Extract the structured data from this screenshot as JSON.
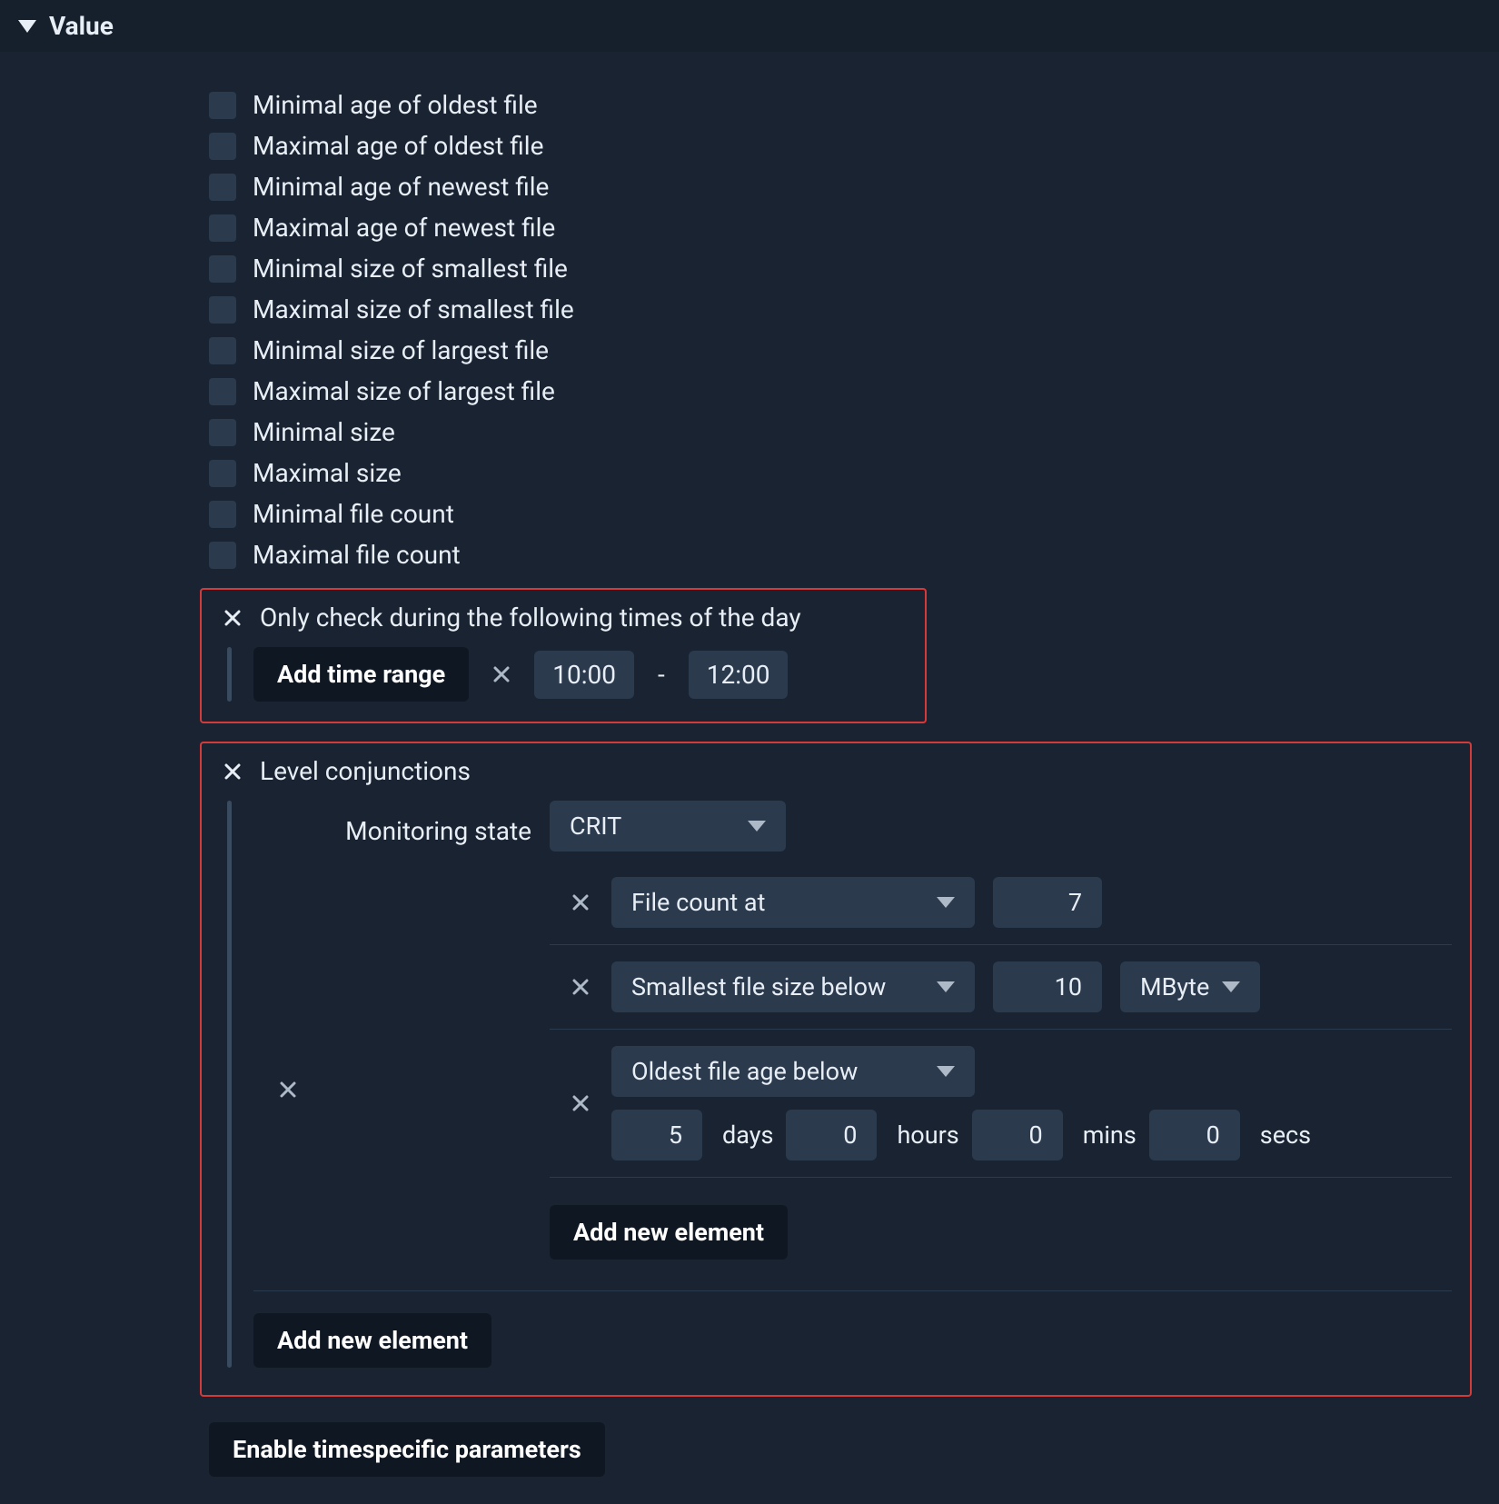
{
  "header": {
    "title": "Value"
  },
  "checks": [
    "Minimal age of oldest file",
    "Maximal age of oldest file",
    "Minimal age of newest file",
    "Maximal age of newest file",
    "Minimal size of smallest file",
    "Maximal size of smallest file",
    "Minimal size of largest file",
    "Maximal size of largest file",
    "Minimal size",
    "Maximal size",
    "Minimal file count",
    "Maximal file count"
  ],
  "time_restrict": {
    "label": "Only check during the following times of the day",
    "add_btn": "Add time range",
    "start": "10:00",
    "end": "12:00"
  },
  "conjunctions": {
    "label": "Level conjunctions",
    "monitoring_state_label": "Monitoring state",
    "monitoring_state_value": "CRIT",
    "conditions": [
      {
        "metric": "File count at",
        "value": "7"
      },
      {
        "metric": "Smallest file size below",
        "value": "10",
        "unit": "MByte"
      },
      {
        "metric": "Oldest file age below",
        "age": {
          "days": "5",
          "days_u": "days",
          "hours": "0",
          "hours_u": "hours",
          "mins": "0",
          "mins_u": "mins",
          "secs": "0",
          "secs_u": "secs"
        }
      }
    ],
    "add_inner": "Add new element",
    "add_outer": "Add new element"
  },
  "timespecific_btn": "Enable timespecific parameters"
}
